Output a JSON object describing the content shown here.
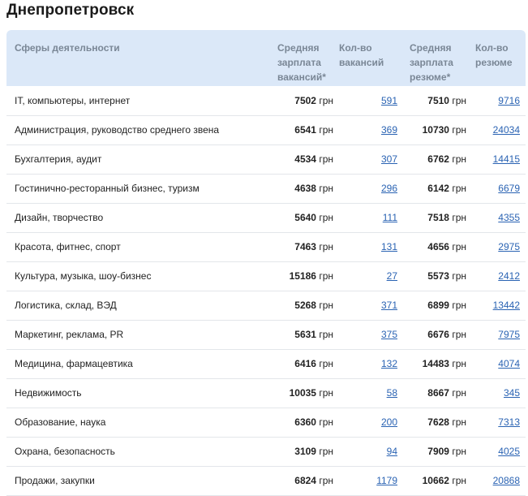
{
  "city_title": "Днепропетровск",
  "headers": {
    "sphere": "Сферы деятельности",
    "vacancy_salary": "Средняя зарплата вакансий*",
    "vacancy_count": "Кол-во вакансий",
    "resume_salary": "Средняя зарплата резюме*",
    "resume_count": "Кол-во резюме"
  },
  "unit": "грн",
  "rows": [
    {
      "sphere": "IT, компьютеры, интернет",
      "vacancy_salary": "7502",
      "vacancy_count": "591",
      "resume_salary": "7510",
      "resume_count": "9716"
    },
    {
      "sphere": "Администрация, руководство среднего звена",
      "vacancy_salary": "6541",
      "vacancy_count": "369",
      "resume_salary": "10730",
      "resume_count": "24034"
    },
    {
      "sphere": "Бухгалтерия, аудит",
      "vacancy_salary": "4534",
      "vacancy_count": "307",
      "resume_salary": "6762",
      "resume_count": "14415"
    },
    {
      "sphere": "Гостинично-ресторанный бизнес, туризм",
      "vacancy_salary": "4638",
      "vacancy_count": "296",
      "resume_salary": "6142",
      "resume_count": "6679"
    },
    {
      "sphere": "Дизайн, творчество",
      "vacancy_salary": "5640",
      "vacancy_count": "111",
      "resume_salary": "7518",
      "resume_count": "4355"
    },
    {
      "sphere": "Красота, фитнес, спорт",
      "vacancy_salary": "7463",
      "vacancy_count": "131",
      "resume_salary": "4656",
      "resume_count": "2975"
    },
    {
      "sphere": "Культура, музыка, шоу-бизнес",
      "vacancy_salary": "15186",
      "vacancy_count": "27",
      "resume_salary": "5573",
      "resume_count": "2412"
    },
    {
      "sphere": "Логистика, склад, ВЭД",
      "vacancy_salary": "5268",
      "vacancy_count": "371",
      "resume_salary": "6899",
      "resume_count": "13442"
    },
    {
      "sphere": "Маркетинг, реклама, PR",
      "vacancy_salary": "5631",
      "vacancy_count": "375",
      "resume_salary": "6676",
      "resume_count": "7975"
    },
    {
      "sphere": "Медицина, фармацевтика",
      "vacancy_salary": "6416",
      "vacancy_count": "132",
      "resume_salary": "14483",
      "resume_count": "4074"
    },
    {
      "sphere": "Недвижимость",
      "vacancy_salary": "10035",
      "vacancy_count": "58",
      "resume_salary": "8667",
      "resume_count": "345"
    },
    {
      "sphere": "Образование, наука",
      "vacancy_salary": "6360",
      "vacancy_count": "200",
      "resume_salary": "7628",
      "resume_count": "7313"
    },
    {
      "sphere": "Охрана, безопасность",
      "vacancy_salary": "3109",
      "vacancy_count": "94",
      "resume_salary": "7909",
      "resume_count": "4025"
    },
    {
      "sphere": "Продажи, закупки",
      "vacancy_salary": "6824",
      "vacancy_count": "1179",
      "resume_salary": "10662",
      "resume_count": "20868"
    }
  ],
  "colors": {
    "header_bg": "#dbe8f8",
    "header_text": "#7a8796",
    "link": "#2a63b3",
    "row_border": "#e3e6ea"
  }
}
